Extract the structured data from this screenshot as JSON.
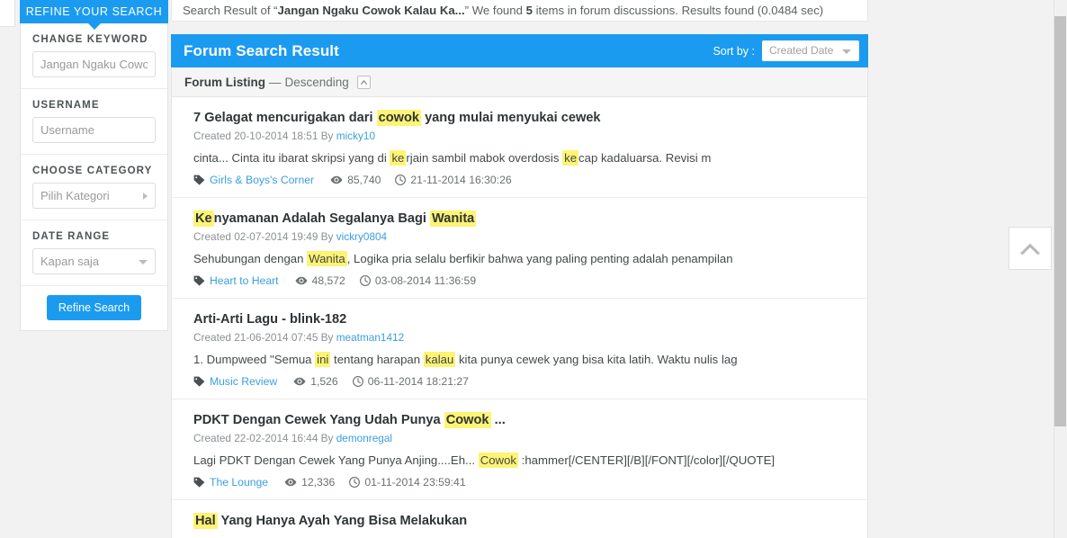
{
  "summary": {
    "prefix": "Search Result of “",
    "query": "Jangan Ngaku Cowok Kalau Ka...",
    "middle": "” We found ",
    "count": "5",
    "suffix": " items in forum discussions. Results found (0.0484 sec)"
  },
  "sidebar": {
    "tab_label": "REFINE YOUR SEARCH",
    "filters": [
      {
        "label": "CHANGE KEYWORD",
        "placeholder": "Jangan Ngaku Cowok Kalau Ka...",
        "type": "text"
      },
      {
        "label": "USERNAME",
        "placeholder": "Username",
        "type": "text"
      },
      {
        "label": "CHOOSE CATEGORY",
        "value": "Pilih Kategori",
        "type": "select-right"
      },
      {
        "label": "DATE RANGE",
        "value": "Kapan saja",
        "type": "select-down"
      }
    ],
    "submit_label": "Refine Search"
  },
  "panel": {
    "title": "Forum Search Result",
    "sort_by_label": "Sort by :",
    "sort_value": "Created Date",
    "listing_label": "Forum Listing",
    "listing_dash": "—",
    "listing_order": "Descending"
  },
  "results": [
    {
      "title_parts": [
        {
          "text": "7 Gelagat mencurigakan dari ",
          "hl": false
        },
        {
          "text": "cowok",
          "hl": true
        },
        {
          "text": " yang mulai menyukai cewek",
          "hl": false
        }
      ],
      "created_label": "Created",
      "created_date": "20-10-2014 18:51",
      "by_label": "By",
      "author": "micky10",
      "snippet_parts": [
        {
          "text": "cinta... Cinta itu ibarat skripsi yang di ",
          "hl": false
        },
        {
          "text": "ke",
          "hl": true
        },
        {
          "text": "rjain sambil mabok overdosis ",
          "hl": false
        },
        {
          "text": "ke",
          "hl": true
        },
        {
          "text": "cap kadaluarsa. Revisi m",
          "hl": false
        }
      ],
      "category": "Girls & Boys's Corner",
      "views": "85,740",
      "time": "21-11-2014 16:30:26"
    },
    {
      "title_parts": [
        {
          "text": "Ke",
          "hl": true
        },
        {
          "text": "nyamanan Adalah Segalanya Bagi ",
          "hl": false
        },
        {
          "text": "Wanita",
          "hl": true
        }
      ],
      "created_label": "Created",
      "created_date": "02-07-2014 19:49",
      "by_label": "By",
      "author": "vickry0804",
      "snippet_parts": [
        {
          "text": "Sehubungan dengan ",
          "hl": false
        },
        {
          "text": "Wanita",
          "hl": true
        },
        {
          "text": ", Logika pria selalu berfikir bahwa yang paling penting adalah penampilan",
          "hl": false
        }
      ],
      "category": "Heart to Heart",
      "views": "48,572",
      "time": "03-08-2014 11:36:59"
    },
    {
      "title_parts": [
        {
          "text": "Arti-Arti Lagu - blink-182",
          "hl": false
        }
      ],
      "created_label": "Created",
      "created_date": "21-06-2014 07:45",
      "by_label": "By",
      "author": "meatman1412",
      "snippet_parts": [
        {
          "text": "1. Dumpweed \"Semua ",
          "hl": false
        },
        {
          "text": "ini",
          "hl": true
        },
        {
          "text": " tentang harapan ",
          "hl": false
        },
        {
          "text": "kalau",
          "hl": true
        },
        {
          "text": " kita punya cewek yang bisa kita latih. Waktu nulis lag",
          "hl": false
        }
      ],
      "category": "Music Review",
      "views": "1,526",
      "time": "06-11-2014 18:21:27"
    },
    {
      "title_parts": [
        {
          "text": "PDKT Dengan Cewek Yang Udah Punya ",
          "hl": false
        },
        {
          "text": "Cowok",
          "hl": true
        },
        {
          "text": " ...",
          "hl": false
        }
      ],
      "created_label": "Created",
      "created_date": "22-02-2014 16:44",
      "by_label": "By",
      "author": "demonregal",
      "snippet_parts": [
        {
          "text": "Lagi PDKT Dengan Cewek Yang Punya Anjing....Eh... ",
          "hl": false
        },
        {
          "text": "Cowok",
          "hl": true
        },
        {
          "text": " :hammer[/CENTER][/B][/FONT][/color][/QUOTE]",
          "hl": false
        }
      ],
      "category": "The Lounge",
      "views": "12,336",
      "time": "01-11-2014 23:59:41"
    },
    {
      "title_parts": [
        {
          "text": "Hal",
          "hl": true
        },
        {
          "text": " Yang Hanya Ayah Yang Bisa Melakukan",
          "hl": false
        }
      ],
      "created_label": "",
      "created_date": "",
      "by_label": "",
      "author": "",
      "snippet_parts": [],
      "category": "",
      "views": "",
      "time": ""
    }
  ],
  "colors": {
    "accent": "#1b9bf0",
    "highlight": "#fdf474",
    "link": "#3a9fe0"
  }
}
